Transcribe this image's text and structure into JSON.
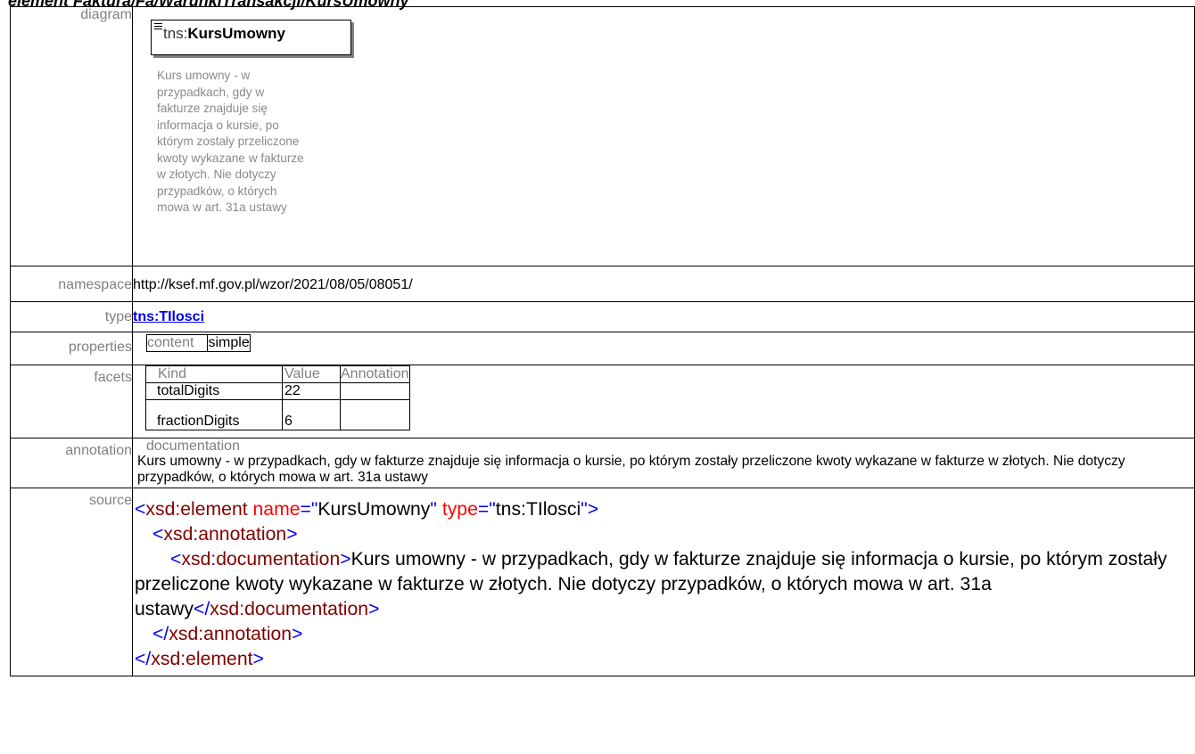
{
  "heading": "element Faktura/Fa/WarunkiTransakcji/KursUmowny",
  "labels": {
    "diagram": "diagram",
    "namespace": "namespace",
    "type": "type",
    "properties": "properties",
    "facets": "facets",
    "annotation": "annotation",
    "source": "source"
  },
  "diagram": {
    "prefix": "tns:",
    "name": "KursUmowny",
    "doc": "Kurs umowny - w\nprzypadkach, gdy w\nfakturze znajduje się\ninformacja o kursie, po\nktórym zostały przeliczone\nkwoty wykazane w fakturze\nw złotych. Nie dotyczy\nprzypadków, o których\nmowa w art. 31a ustawy"
  },
  "namespace": "http://ksef.mf.gov.pl/wzor/2021/08/05/08051/",
  "type": "tns:TIlosci",
  "properties": {
    "key": "content",
    "value": "simple"
  },
  "facets": {
    "headers": [
      "Kind",
      "Value",
      "Annotation"
    ],
    "rows": [
      {
        "kind": "totalDigits",
        "value": "22"
      },
      {
        "kind": "fractionDigits",
        "value": "6"
      }
    ]
  },
  "annotation": {
    "header": "documentation",
    "text": "Kurs umowny - w przypadkach, gdy w fakturze znajduje się informacja o kursie, po którym zostały przeliczone kwoty wykazane w fakturze w złotych. Nie dotyczy przypadków, o których mowa w art. 31a ustawy"
  },
  "source": {
    "lt": "<",
    "gt": ">",
    "close_lt": "</",
    "eq": "=",
    "q": "\"",
    "element_tag": "xsd:element",
    "attr_name": "name",
    "attr_name_value": "KursUmowny",
    "attr_type": "type",
    "attr_type_value": "tns:TIlosci",
    "annotation_tag": "xsd:annotation",
    "documentation_tag": "xsd:documentation",
    "documentation_text": "Kurs umowny - w przypadkach, gdy w fakturze znajduje się informacja o kursie, po którym zostały przeliczone kwoty wykazane w fakturze w złotych. Nie dotyczy przypadków, o których mowa w art. 31a ustawy"
  }
}
